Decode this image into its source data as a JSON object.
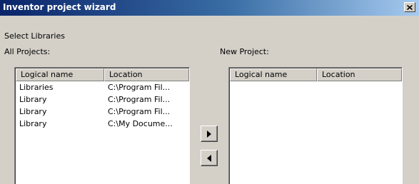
{
  "window": {
    "title": "Inventor project wizard",
    "close_label": "×"
  },
  "section_label": "Select Libraries",
  "all_projects": {
    "label": "All Projects:",
    "columns": [
      "Logical name",
      "Location"
    ],
    "rows": [
      [
        "Libraries",
        "C:\\Program Fil..."
      ],
      [
        "Library",
        "C:\\Program Fil..."
      ],
      [
        "Library",
        "C:\\Program Fil..."
      ],
      [
        "Library",
        "C:\\My Docume..."
      ]
    ]
  },
  "new_project": {
    "label": "New Project:",
    "columns": [
      "Logical name",
      "Location"
    ],
    "rows": []
  },
  "buttons": {
    "add_icon": "triangle-right-icon",
    "remove_icon": "triangle-left-icon"
  },
  "colors": {
    "title_gradient_start": "#0a246a",
    "title_gradient_end": "#a6caf0",
    "dialog_face": "#d4d0c8"
  }
}
